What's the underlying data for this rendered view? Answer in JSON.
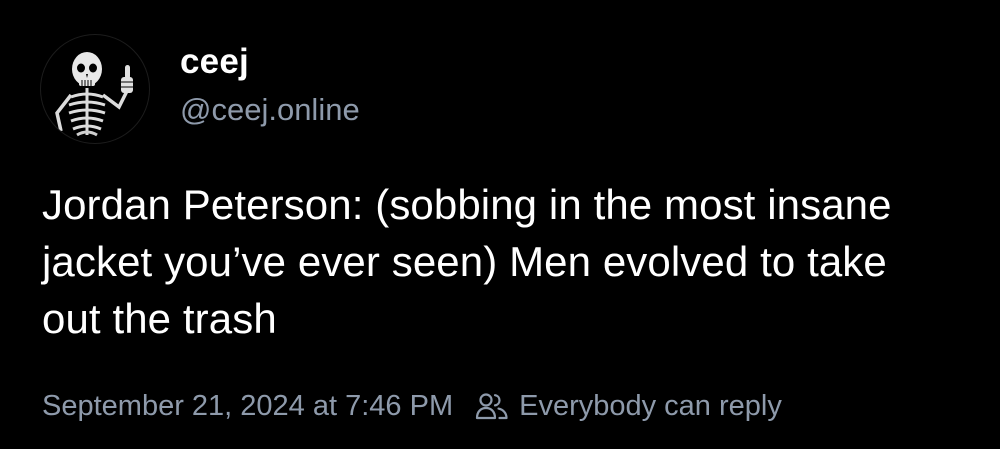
{
  "author": {
    "display_name": "ceej",
    "handle": "@ceej.online",
    "avatar_icon": "skeleton-thumbs-up-icon"
  },
  "post": {
    "text": "Jordan Peterson: (sobbing in the most insane jacket you’ve ever seen) Men evolved to take out the trash"
  },
  "meta": {
    "timestamp": "September 21, 2024 at 7:46 PM",
    "reply_setting": "Everybody can reply",
    "reply_icon": "people-icon"
  },
  "colors": {
    "background": "#000000",
    "text": "#ffffff",
    "muted": "#8e9aab"
  }
}
